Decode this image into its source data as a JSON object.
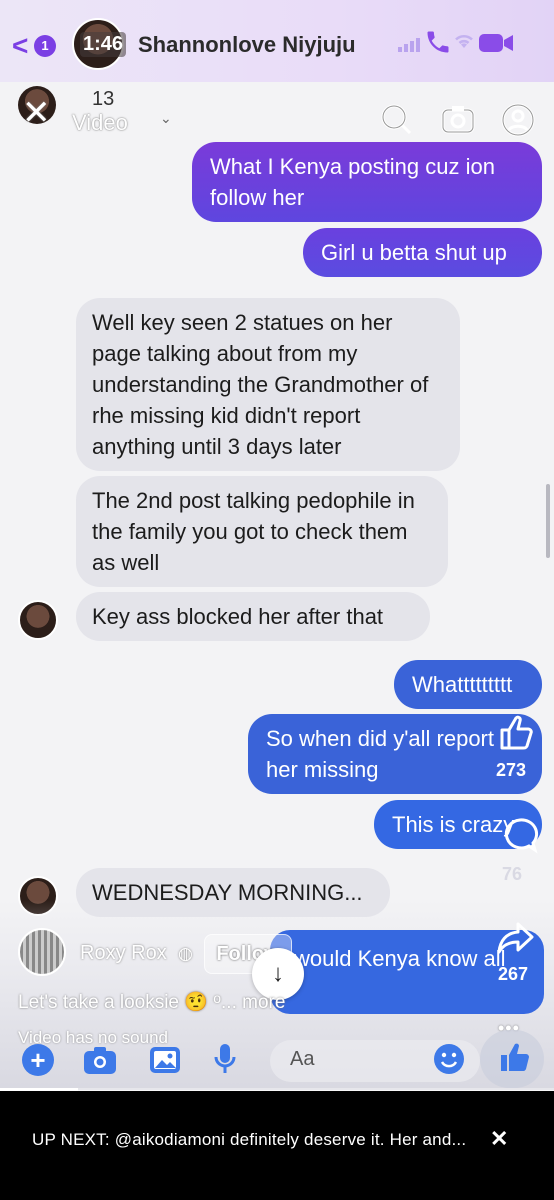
{
  "header": {
    "back_badge": "1",
    "clock": "1:46",
    "contact_name": "Shannonlove Niyjuju"
  },
  "overlay": {
    "count": "13",
    "video_label": "Video"
  },
  "messages": [
    {
      "dir": "out",
      "text": "What I Kenya posting cuz ion follow her"
    },
    {
      "dir": "out",
      "text": "Girl u betta shut up"
    },
    {
      "dir": "in",
      "text": "Well key seen 2 statues on her page talking about from my understanding the Grandmother of rhe missing kid didn't report anything until 3 days later"
    },
    {
      "dir": "in",
      "text": "The 2nd post talking pedophile in the family you got to check them as well"
    },
    {
      "dir": "in",
      "text": "Key ass blocked her after that"
    },
    {
      "dir": "out",
      "text": "Whattttttttt"
    },
    {
      "dir": "out",
      "text": "So when did y'all report her missing"
    },
    {
      "dir": "out",
      "text": "This is crazy"
    },
    {
      "dir": "in",
      "text": "WEDNESDAY MORNING..."
    },
    {
      "dir": "out",
      "text": "would Kenya know all"
    }
  ],
  "reactions": {
    "like_count": "273",
    "comment_count": "76",
    "share_count": "267"
  },
  "reel": {
    "author": "Roxy Rox",
    "follow_label": "Follow",
    "caption": "Let's take a looksie 🤨",
    "more_label": "... more",
    "caption_o": "o",
    "no_sound": "Video has no sound",
    "more_dots": "•••"
  },
  "composer": {
    "placeholder": "Aa",
    "progress": 0.14
  },
  "up_next": {
    "text": "UP NEXT: @aikodiamoni definitely deserve it. Her and...",
    "close": "✕"
  },
  "colors": {
    "accent_purple": "#7b3fe4",
    "bubble_out_blue": "#3a63d8",
    "bubble_in": "#e4e4ea"
  }
}
